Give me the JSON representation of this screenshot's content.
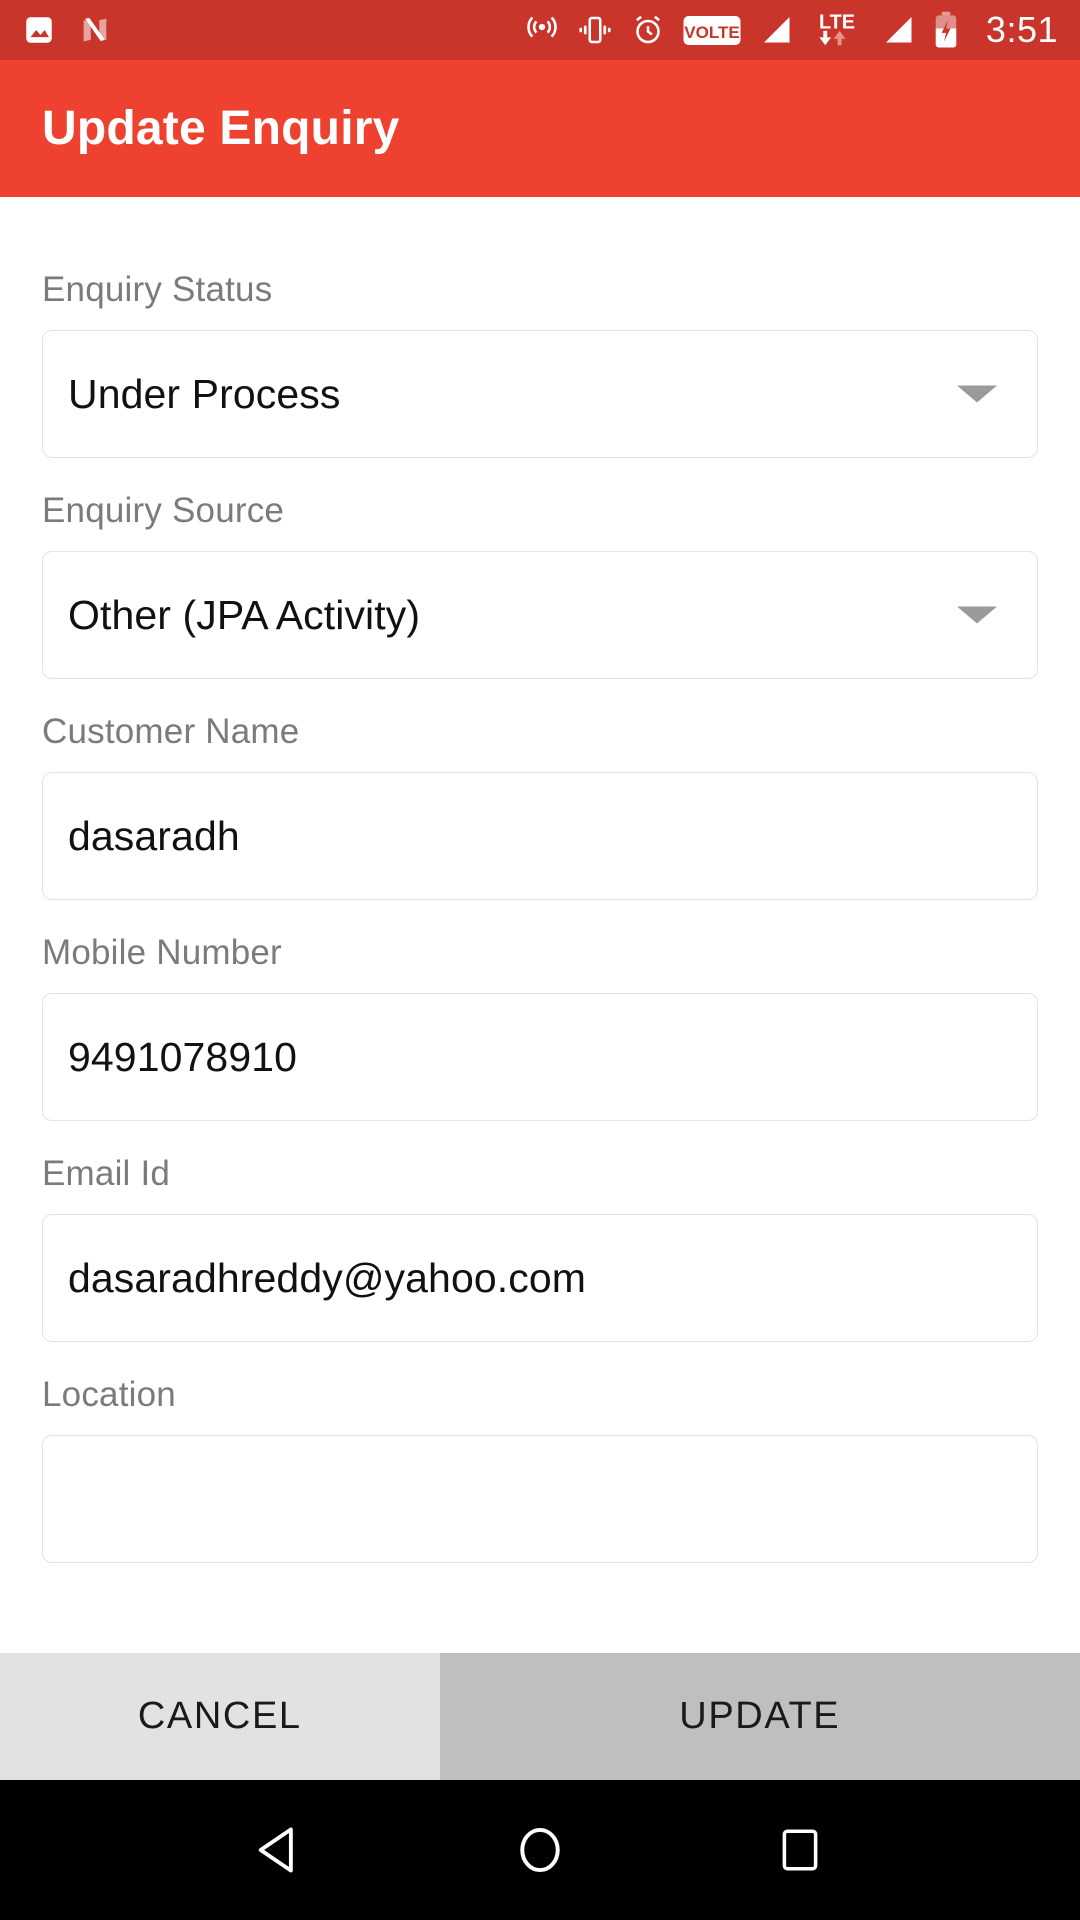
{
  "status_bar": {
    "time": "3:51",
    "left_icons": [
      "image-icon",
      "android-nougat-icon"
    ],
    "right_icons": [
      "hotspot-icon",
      "vibrate-icon",
      "alarm-icon",
      "volte-badge",
      "signal-1-icon",
      "lte-data-icon",
      "signal-2-icon",
      "battery-charging-icon"
    ],
    "volte_label": "VOLTE",
    "lte_label": "LTE",
    "background_color": "#c9342b"
  },
  "app_bar": {
    "title": "Update Enquiry",
    "background_color": "#ef4130",
    "title_color": "#ffffff"
  },
  "form": {
    "fields": [
      {
        "label": "Enquiry Status",
        "value": "Under Process",
        "type": "dropdown"
      },
      {
        "label": "Enquiry Source",
        "value": "Other (JPA Activity)",
        "type": "dropdown"
      },
      {
        "label": "Customer Name",
        "value": "dasaradh",
        "type": "text"
      },
      {
        "label": "Mobile Number",
        "value": "9491078910",
        "type": "text"
      },
      {
        "label": "Email Id",
        "value": "dasaradhreddy@yahoo.com",
        "type": "text"
      },
      {
        "label": "Location",
        "value": "",
        "type": "text"
      }
    ]
  },
  "buttons": {
    "cancel_label": "CANCEL",
    "update_label": "UPDATE",
    "cancel_color": "#e2e2e2",
    "update_color": "#bfbfbf"
  },
  "nav_bar": {
    "items": [
      "back-icon",
      "home-icon",
      "recents-icon"
    ],
    "background_color": "#000000"
  }
}
